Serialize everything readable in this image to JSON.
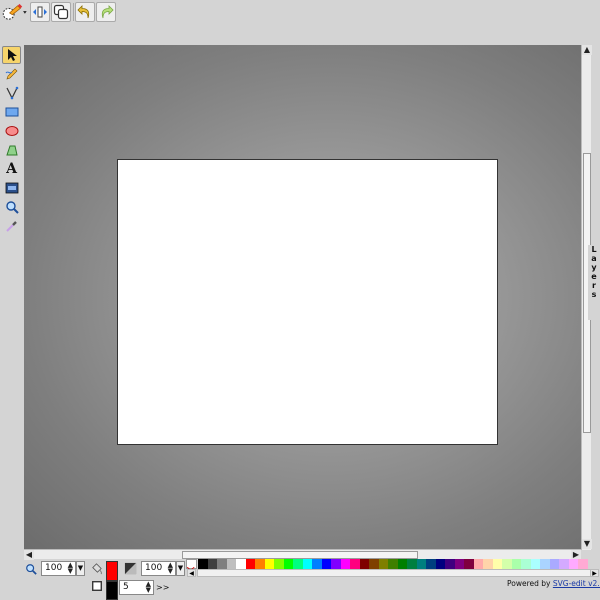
{
  "toolbar": {
    "buttons": [
      "main-menu",
      "zoom-fit",
      "clone",
      "undo",
      "redo"
    ]
  },
  "tools": {
    "items": [
      "select",
      "freehand-pencil",
      "path",
      "rectangle",
      "ellipse",
      "polygon",
      "text",
      "image",
      "zoom",
      "eyedropper"
    ],
    "active": "select",
    "text_tool_glyph": "A"
  },
  "zoom": {
    "value": "100"
  },
  "opacity": {
    "value": "100"
  },
  "stroke": {
    "width": "5",
    "more_label": ">>"
  },
  "fill": {
    "color": "#ff0000"
  },
  "stroke_color": "#000000",
  "layers": {
    "label": "Layers"
  },
  "palette": {
    "colors": [
      "#000000",
      "#3f3f3f",
      "#7f7f7f",
      "#bfbfbf",
      "#ffffff",
      "#ff0000",
      "#ff7f00",
      "#ffff00",
      "#7fff00",
      "#00ff00",
      "#00ff7f",
      "#00ffff",
      "#007fff",
      "#0000ff",
      "#7f00ff",
      "#ff00ff",
      "#ff007f",
      "#7f0000",
      "#7f3f00",
      "#7f7f00",
      "#3f7f00",
      "#007f00",
      "#007f3f",
      "#007f7f",
      "#003f7f",
      "#00007f",
      "#3f007f",
      "#7f007f",
      "#7f003f",
      "#ffaaaa",
      "#ffd4aa",
      "#ffffaa",
      "#d4ffaa",
      "#aaffaa",
      "#aaffd4",
      "#aaffff",
      "#aad4ff",
      "#aaaaff",
      "#d4aaff",
      "#ffaaff",
      "#ffaad4"
    ]
  },
  "footer": {
    "powered_by": "Powered by",
    "link_text": "SVG-edit v2.5.1"
  }
}
